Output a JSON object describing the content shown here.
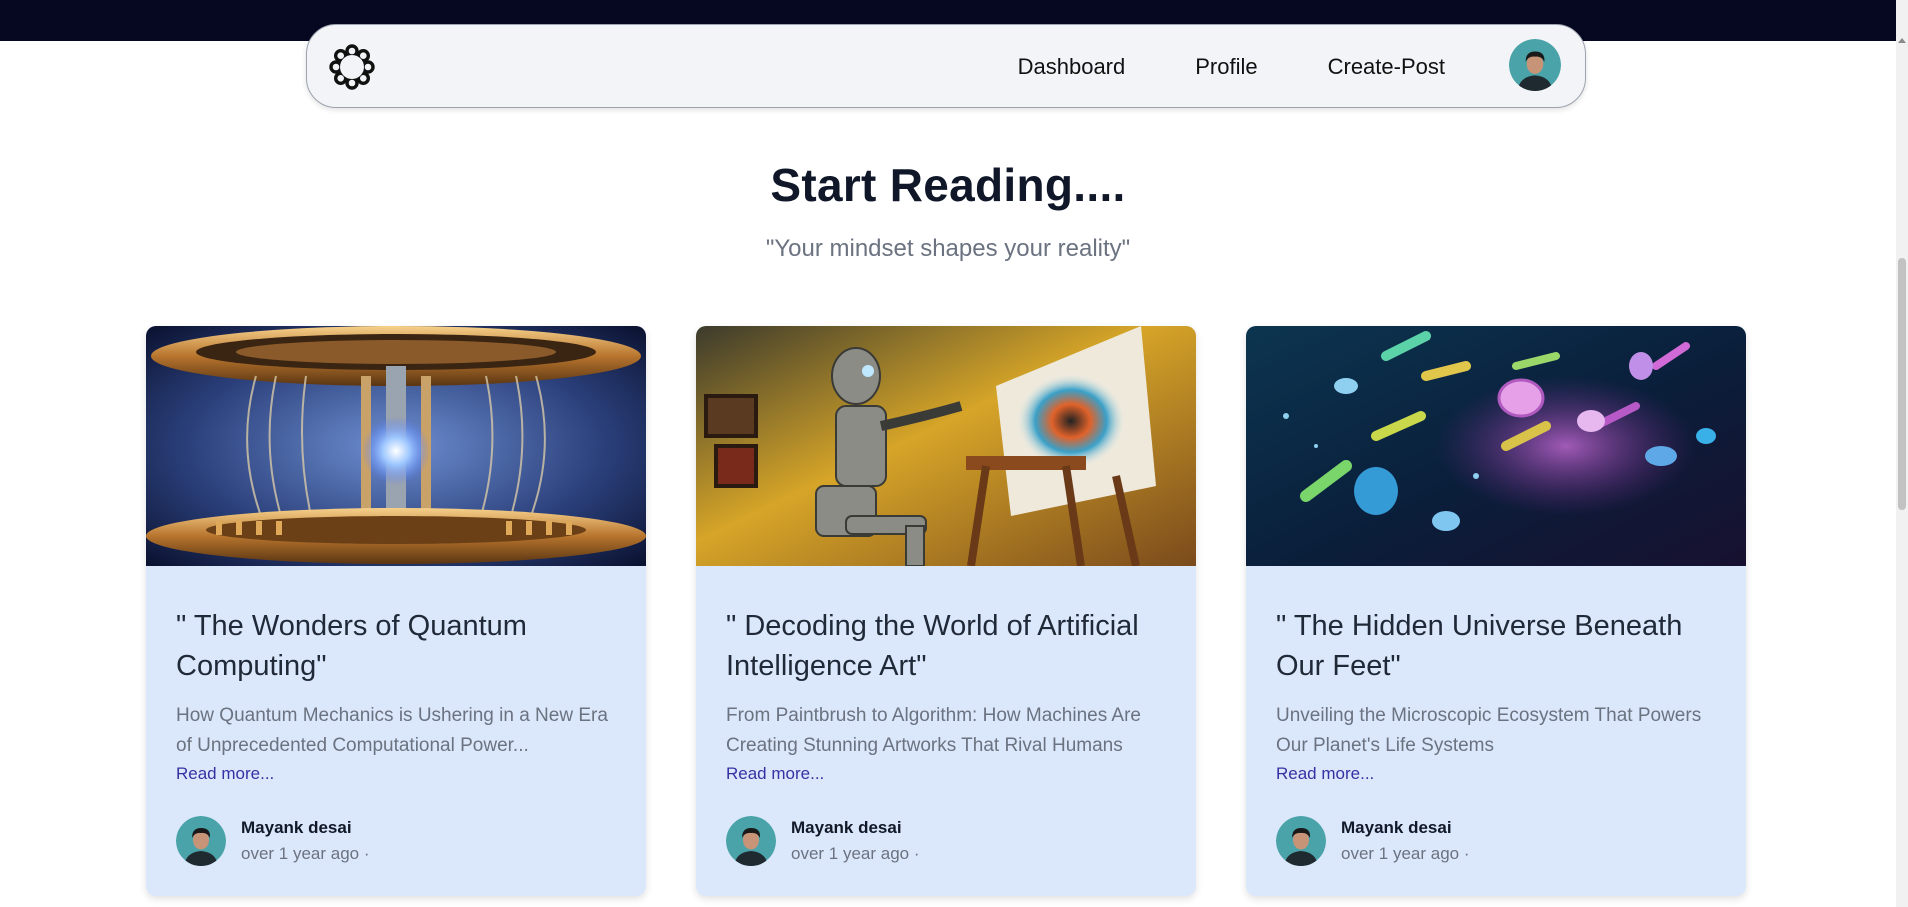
{
  "nav": {
    "logo_icon": "flower-ring-logo-icon",
    "links": [
      "Dashboard",
      "Profile",
      "Create-Post"
    ],
    "avatar_icon": "user-avatar"
  },
  "hero": {
    "title": "Start Reading....",
    "subtitle": "\"Your mindset shapes your reality\""
  },
  "posts": [
    {
      "title": "\" The Wonders of Quantum Computing\"",
      "description": "How Quantum Mechanics is Ushering in a New Era of Unprecedented Computational Power...",
      "read_more": "Read more...",
      "author": "Mayank desai",
      "time": "over 1 year ago ·",
      "image": "quantum-computer-image"
    },
    {
      "title": "\" Decoding the World of Artificial Intelligence Art\"",
      "description": "From Paintbrush to Algorithm: How Machines Are Creating Stunning Artworks That Rival Humans",
      "read_more": "Read more...",
      "author": "Mayank desai",
      "time": "over 1 year ago ·",
      "image": "robot-painting-image"
    },
    {
      "title": "\" The Hidden Universe Beneath Our Feet\"",
      "description": "Unveiling the Microscopic Ecosystem That Powers Our Planet's Life Systems",
      "read_more": "Read more...",
      "author": "Mayank desai",
      "time": "over 1 year ago ·",
      "image": "microbes-image"
    }
  ],
  "colors": {
    "card_bg": "#dbe8fb",
    "link": "#3730a3",
    "heading": "#0f1729",
    "top_strip": "#050820"
  }
}
